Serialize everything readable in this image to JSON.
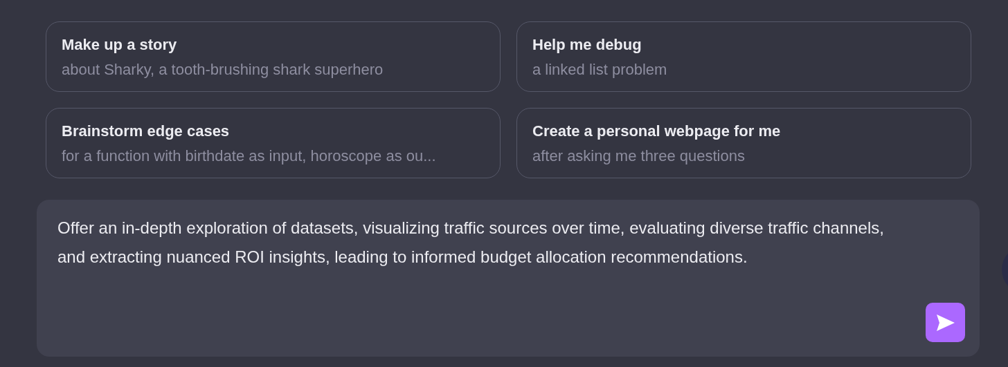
{
  "suggestions": [
    {
      "title": "Make up a story",
      "subtitle": "about Sharky, a tooth-brushing shark superhero"
    },
    {
      "title": "Help me debug",
      "subtitle": "a linked list problem"
    },
    {
      "title": "Brainstorm edge cases",
      "subtitle": "for a function with birthdate as input, horoscope as ou..."
    },
    {
      "title": "Create a personal webpage for me",
      "subtitle": "after asking me three questions"
    }
  ],
  "composer": {
    "value": "Offer an in-depth exploration of datasets, visualizing traffic sources over time, evaluating diverse traffic channels, and extracting nuanced ROI insights, leading to informed budget allocation recommendations."
  }
}
